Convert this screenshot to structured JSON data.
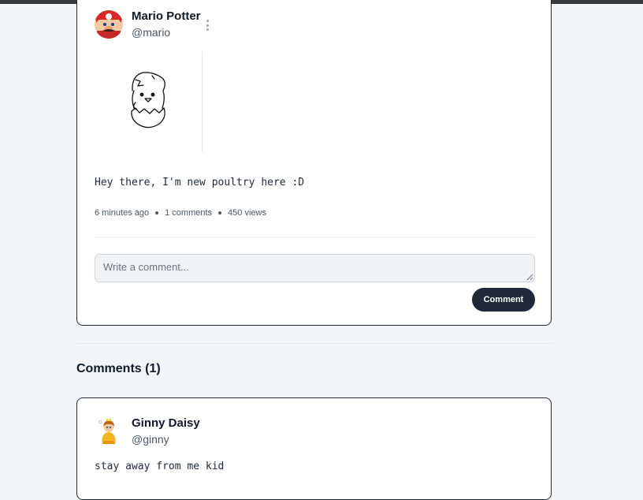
{
  "post": {
    "author": {
      "name": "Mario Potter",
      "handle": "@mario",
      "avatar_icon": "mario-avatar-icon"
    },
    "image_icon": "hatching-chick-drawing",
    "text": "Hey there, I'm new poultry here :D",
    "meta": {
      "time": "6 minutes ago",
      "comments": "1 comments",
      "views": "450 views"
    }
  },
  "comment_form": {
    "placeholder": "Write a comment...",
    "value": "",
    "button_label": "Comment"
  },
  "comments_section": {
    "title": "Comments (1)",
    "items": [
      {
        "name": "Ginny Daisy",
        "handle": "@ginny",
        "avatar_icon": "daisy-avatar-icon",
        "text": "stay away from me kid"
      }
    ]
  },
  "colors": {
    "accent": "#1f2937",
    "background": "#f3f4f6",
    "card": "#ffffff"
  }
}
